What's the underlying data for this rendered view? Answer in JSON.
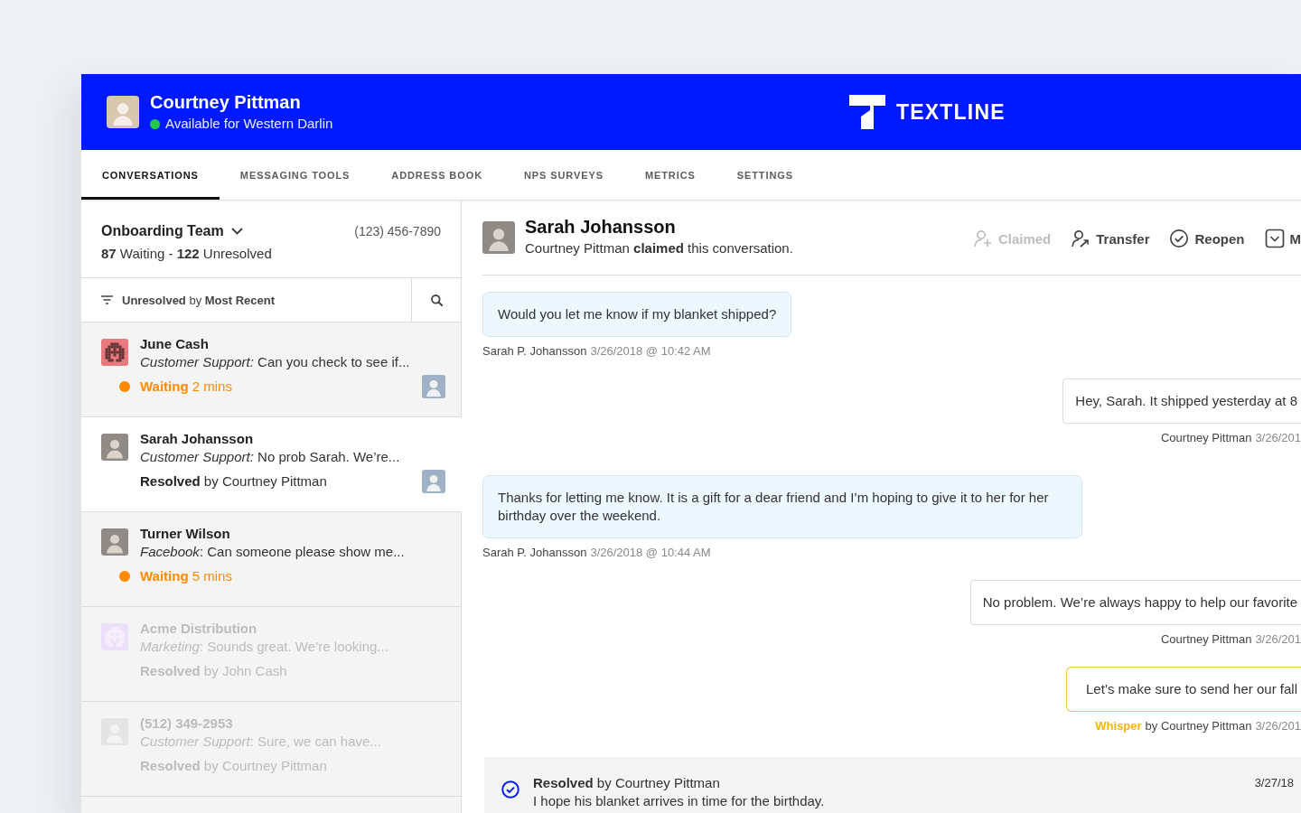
{
  "header": {
    "user": {
      "name": "Courtney Pittman",
      "available": true,
      "status": "Available for Western Darlin"
    },
    "logo": {
      "text": "TEXTLINE"
    }
  },
  "tabs": [
    {
      "label": "CONVERSATIONS",
      "selected": true
    },
    {
      "label": "MESSAGING TOOLS",
      "selected": false
    },
    {
      "label": "ADDRESS BOOK",
      "selected": false
    },
    {
      "label": "NPS SURVEYS",
      "selected": false
    },
    {
      "label": "METRICS",
      "selected": false
    },
    {
      "label": "SETTINGS",
      "selected": false
    }
  ],
  "inbox": {
    "team": "Onboarding Team",
    "phone": "(123) 456-7890",
    "summary": "**87** Waiting - **122** Unresolved",
    "filter": "**Unresolved** by **Most Recent**",
    "conversations": [
      {
        "name": "June Cash",
        "avatar": {
          "kind": "pixel",
          "color": "#e8797f"
        },
        "preview": "*Customer Support:* Can you check to see if...",
        "status": {
          "kind": "waiting",
          "label": "Waiting",
          "detail": "2 mins"
        },
        "assignee_photo": true,
        "selected": false,
        "dimmed": false
      },
      {
        "name": "Sarah Johansson",
        "avatar": {
          "kind": "photo"
        },
        "preview": "*Customer Support:* No prob Sarah. We’re...",
        "status": {
          "kind": "resolved",
          "label": "Resolved",
          "detail": "by Courtney Pittman"
        },
        "assignee_photo": true,
        "selected": true,
        "dimmed": false
      },
      {
        "name": "Turner Wilson",
        "avatar": {
          "kind": "photo"
        },
        "preview": "*Facebook*: Can someone please show me...",
        "status": {
          "kind": "waiting",
          "label": "Waiting",
          "detail": "5 mins"
        },
        "assignee_photo": false,
        "selected": false,
        "dimmed": false
      },
      {
        "name": "Acme Distribution",
        "avatar": {
          "kind": "pixel",
          "color": "#ecdff9"
        },
        "preview": "*Marketing*: Sounds great. We’re looking...",
        "status": {
          "kind": "resolved",
          "label": "Resolved",
          "detail": "by John Cash"
        },
        "assignee_photo": false,
        "selected": false,
        "dimmed": true
      },
      {
        "name": "(512) 349-2953",
        "avatar": {
          "kind": "photo"
        },
        "preview": "*Customer Support*: Sure, we can have...",
        "status": {
          "kind": "resolved",
          "label": "Resolved",
          "detail": "by Courtney Pittman"
        },
        "assignee_photo": false,
        "selected": false,
        "dimmed": true
      }
    ]
  },
  "conversation": {
    "contact": "Sarah Johansson",
    "activity": "Courtney Pittman **claimed** this conversation.",
    "actions": [
      {
        "kind": "claim",
        "label": "Claimed",
        "disabled": true
      },
      {
        "kind": "transfer",
        "label": "Transfer",
        "disabled": false
      },
      {
        "kind": "reopen",
        "label": "Reopen",
        "disabled": false
      },
      {
        "kind": "mark",
        "label": "M",
        "disabled": false
      }
    ],
    "messages": [
      {
        "kind": "incoming",
        "text": "Would you let me know if my blanket shipped?",
        "sender": "Sarah P. Johansson",
        "time": "3/26/2018 @ 10:42 AM"
      },
      {
        "kind": "outgoing",
        "text": "Hey, Sarah. It shipped yesterday at 8",
        "sender": "Courtney Pittman",
        "time": "3/26/201"
      },
      {
        "kind": "incoming",
        "text": "Thanks for letting me know. It is a gift for a dear friend and I’m hoping to give it to her for her birthday over the weekend.",
        "sender": "Sarah P. Johansson",
        "time": "3/26/2018 @ 10:44 AM"
      },
      {
        "kind": "outgoing",
        "text": "No problem. We’re always happy to help our favorite",
        "sender": "Courtney Pittman",
        "time": "3/26/201"
      },
      {
        "kind": "whisper",
        "text": "Let’s make sure to send her our fall",
        "tag": "Whisper",
        "sender": "by Courtney Pittman",
        "time": "3/26/201"
      }
    ],
    "event": {
      "kind": "resolved",
      "title": "**Resolved** by Courtney Pittman",
      "note": "I hope his blanket arrives in time for the birthday.",
      "time": "3/27/18"
    }
  }
}
